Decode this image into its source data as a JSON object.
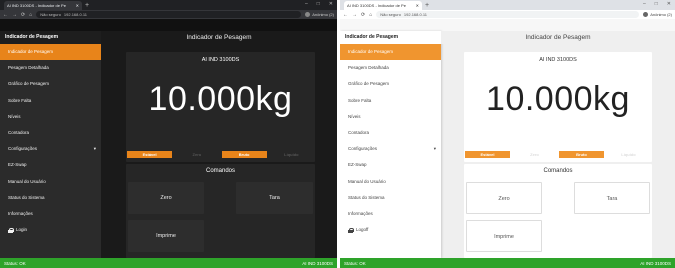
{
  "browser": {
    "tab_title": "AI IND 3100DS - Indicador de Pe",
    "new_tab": "+",
    "window_controls": {
      "minimize": "–",
      "maximize": "□",
      "close": "✕"
    },
    "nav": {
      "back": "←",
      "forward": "→",
      "reload": "⟳",
      "home": "⌂"
    },
    "url_security": "Não seguro",
    "url_text": "192.168.0.11",
    "profile": "Anônimo (2)"
  },
  "sidebar": {
    "title": "Indicador de Pesagem",
    "items": [
      {
        "label": "Indicador de Pesagem"
      },
      {
        "label": "Pesagem Detalhada"
      },
      {
        "label": "Gráfico de Pesagem"
      },
      {
        "label": "Sobre Falta"
      },
      {
        "label": "Níveis"
      },
      {
        "label": "Contadora"
      },
      {
        "label": "Configurações",
        "chevron": "▾"
      },
      {
        "label": "EZ-Swap"
      },
      {
        "label": "Manual do Usuário"
      },
      {
        "label": "Status do Sistema"
      },
      {
        "label": "Informações"
      }
    ],
    "login_label_dark": "Login",
    "login_label_light": "Logoff"
  },
  "header": {
    "title": "Indicador de Pesagem"
  },
  "indicator": {
    "model": "AI IND 3100DS",
    "weight": "10.000kg",
    "status": [
      "Estável",
      "Zero",
      "Bruto",
      "Líquido"
    ]
  },
  "commands": {
    "title": "Comandos",
    "zero": "Zero",
    "tare": "Tara",
    "print": "Imprime"
  },
  "statusbar": {
    "left": "Status: OK",
    "right": "AI IND 3100DS"
  },
  "colors": {
    "accent": "#e8841a",
    "status_green": "#2ea32a",
    "active_status": "#e8841a"
  }
}
